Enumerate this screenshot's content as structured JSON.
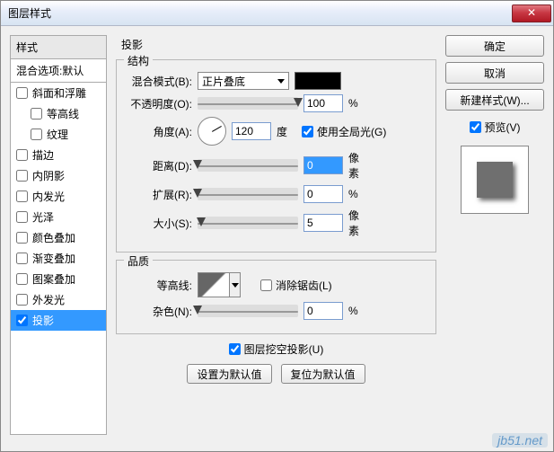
{
  "dialog": {
    "title": "图层样式"
  },
  "left": {
    "header": "样式",
    "blend_defaults": "混合选项:默认",
    "items": [
      {
        "label": "斜面和浮雕",
        "checked": false,
        "indent": false,
        "selected": false
      },
      {
        "label": "等高线",
        "checked": false,
        "indent": true,
        "selected": false
      },
      {
        "label": "纹理",
        "checked": false,
        "indent": true,
        "selected": false
      },
      {
        "label": "描边",
        "checked": false,
        "indent": false,
        "selected": false
      },
      {
        "label": "内阴影",
        "checked": false,
        "indent": false,
        "selected": false
      },
      {
        "label": "内发光",
        "checked": false,
        "indent": false,
        "selected": false
      },
      {
        "label": "光泽",
        "checked": false,
        "indent": false,
        "selected": false
      },
      {
        "label": "颜色叠加",
        "checked": false,
        "indent": false,
        "selected": false
      },
      {
        "label": "渐变叠加",
        "checked": false,
        "indent": false,
        "selected": false
      },
      {
        "label": "图案叠加",
        "checked": false,
        "indent": false,
        "selected": false
      },
      {
        "label": "外发光",
        "checked": false,
        "indent": false,
        "selected": false
      },
      {
        "label": "投影",
        "checked": true,
        "indent": false,
        "selected": true
      }
    ]
  },
  "mid": {
    "section_title": "投影",
    "structure_legend": "结构",
    "blend_mode": {
      "label": "混合模式(B):",
      "value": "正片叠底",
      "color": "#000000"
    },
    "opacity": {
      "label": "不透明度(O):",
      "value": "100",
      "unit": "%",
      "pct": 100
    },
    "angle": {
      "label": "角度(A):",
      "value": "120",
      "unit": "度"
    },
    "use_global": {
      "label": "使用全局光(G)",
      "checked": true
    },
    "distance": {
      "label": "距离(D):",
      "value": "0",
      "unit": "像素",
      "pct": 0
    },
    "spread": {
      "label": "扩展(R):",
      "value": "0",
      "unit": "%",
      "pct": 0
    },
    "size": {
      "label": "大小(S):",
      "value": "5",
      "unit": "像素",
      "pct": 4
    },
    "quality_legend": "品质",
    "contour": {
      "label": "等高线:"
    },
    "antialias": {
      "label": "消除锯齿(L)",
      "checked": false
    },
    "noise": {
      "label": "杂色(N):",
      "value": "0",
      "unit": "%",
      "pct": 0
    },
    "knockout": {
      "label": "图层挖空投影(U)",
      "checked": true
    },
    "set_default": "设置为默认值",
    "reset_default": "复位为默认值"
  },
  "right": {
    "ok": "确定",
    "cancel": "取消",
    "new_style": "新建样式(W)...",
    "preview": {
      "label": "预览(V)",
      "checked": true
    }
  },
  "watermark": "jb51.net"
}
